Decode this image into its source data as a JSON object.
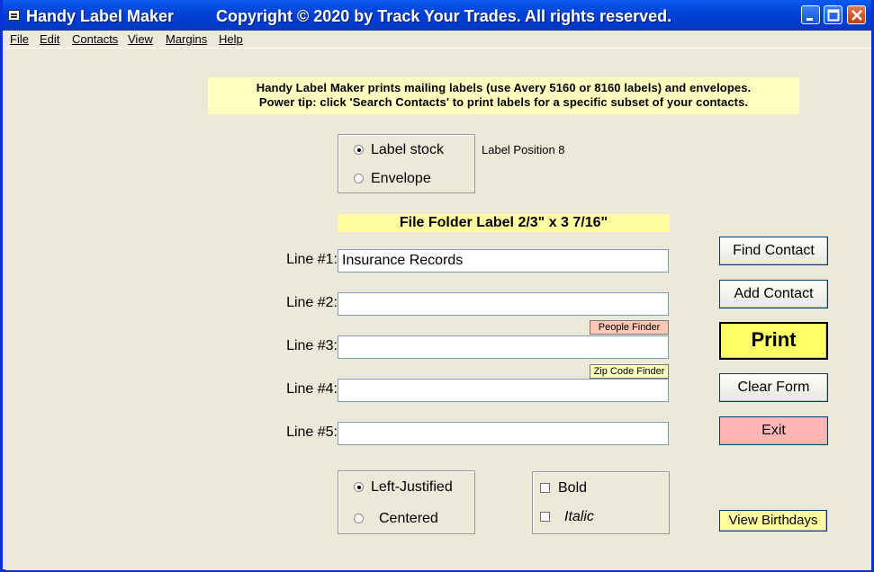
{
  "window": {
    "title": "Handy Label Maker",
    "copyright": "Copyright © 2020 by Track Your Trades.  All rights reserved."
  },
  "menu": [
    "File",
    "Edit",
    "Contacts",
    "View",
    "Margins",
    "Help"
  ],
  "tips": {
    "line1": "Handy Label Maker prints mailing labels (use Avery 5160 or 8160 labels) and envelopes.",
    "line2": "Power tip: click 'Search Contacts' to print labels for a specific subset of your contacts."
  },
  "stock": {
    "label_stock": "Label stock",
    "envelope": "Envelope",
    "selected": "Label stock",
    "position": "Label Position 8"
  },
  "label_type": "File Folder Label 2/3\" x 3 7/16\"",
  "lines": [
    {
      "label": "Line #1:",
      "value": "Insurance Records"
    },
    {
      "label": "Line #2:",
      "value": ""
    },
    {
      "label": "Line #3:",
      "value": ""
    },
    {
      "label": "Line #4:",
      "value": ""
    },
    {
      "label": "Line #5:",
      "value": ""
    }
  ],
  "finders": {
    "people": "People Finder",
    "zip": "Zip Code Finder"
  },
  "justify": {
    "left": "Left-Justified",
    "centered": "Centered",
    "selected": "Left-Justified"
  },
  "style": {
    "bold": "Bold",
    "italic": "Italic",
    "bold_checked": false,
    "italic_checked": false
  },
  "buttons": {
    "find_contact": "Find Contact",
    "add_contact": "Add Contact",
    "print": "Print",
    "clear_form": "Clear Form",
    "exit": "Exit",
    "view_birthdays": "View Birthdays"
  },
  "colors": {
    "titlebar": "#0042d6",
    "form_bg": "#ece9d8",
    "tip_bg": "#ffffc0",
    "print_bg": "#ffff66",
    "exit_bg": "#ffb6b6",
    "people_finder_bg": "#ffc8b4",
    "zip_finder_bg": "#ffffc0"
  }
}
